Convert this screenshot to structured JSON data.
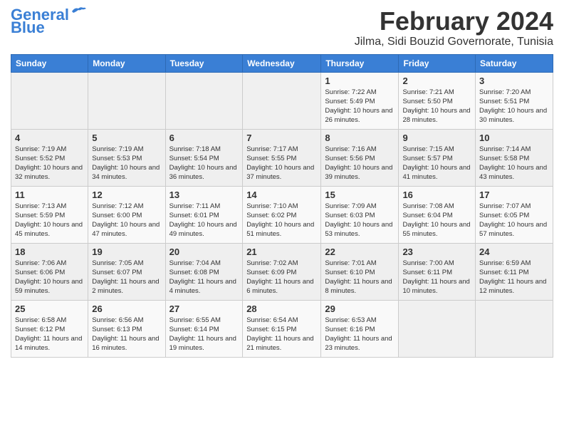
{
  "logo": {
    "line1": "General",
    "line2": "Blue"
  },
  "title": "February 2024",
  "subtitle": "Jilma, Sidi Bouzid Governorate, Tunisia",
  "days_of_week": [
    "Sunday",
    "Monday",
    "Tuesday",
    "Wednesday",
    "Thursday",
    "Friday",
    "Saturday"
  ],
  "weeks": [
    [
      {
        "day": "",
        "info": ""
      },
      {
        "day": "",
        "info": ""
      },
      {
        "day": "",
        "info": ""
      },
      {
        "day": "",
        "info": ""
      },
      {
        "day": "1",
        "info": "Sunrise: 7:22 AM\nSunset: 5:49 PM\nDaylight: 10 hours and 26 minutes."
      },
      {
        "day": "2",
        "info": "Sunrise: 7:21 AM\nSunset: 5:50 PM\nDaylight: 10 hours and 28 minutes."
      },
      {
        "day": "3",
        "info": "Sunrise: 7:20 AM\nSunset: 5:51 PM\nDaylight: 10 hours and 30 minutes."
      }
    ],
    [
      {
        "day": "4",
        "info": "Sunrise: 7:19 AM\nSunset: 5:52 PM\nDaylight: 10 hours and 32 minutes."
      },
      {
        "day": "5",
        "info": "Sunrise: 7:19 AM\nSunset: 5:53 PM\nDaylight: 10 hours and 34 minutes."
      },
      {
        "day": "6",
        "info": "Sunrise: 7:18 AM\nSunset: 5:54 PM\nDaylight: 10 hours and 36 minutes."
      },
      {
        "day": "7",
        "info": "Sunrise: 7:17 AM\nSunset: 5:55 PM\nDaylight: 10 hours and 37 minutes."
      },
      {
        "day": "8",
        "info": "Sunrise: 7:16 AM\nSunset: 5:56 PM\nDaylight: 10 hours and 39 minutes."
      },
      {
        "day": "9",
        "info": "Sunrise: 7:15 AM\nSunset: 5:57 PM\nDaylight: 10 hours and 41 minutes."
      },
      {
        "day": "10",
        "info": "Sunrise: 7:14 AM\nSunset: 5:58 PM\nDaylight: 10 hours and 43 minutes."
      }
    ],
    [
      {
        "day": "11",
        "info": "Sunrise: 7:13 AM\nSunset: 5:59 PM\nDaylight: 10 hours and 45 minutes."
      },
      {
        "day": "12",
        "info": "Sunrise: 7:12 AM\nSunset: 6:00 PM\nDaylight: 10 hours and 47 minutes."
      },
      {
        "day": "13",
        "info": "Sunrise: 7:11 AM\nSunset: 6:01 PM\nDaylight: 10 hours and 49 minutes."
      },
      {
        "day": "14",
        "info": "Sunrise: 7:10 AM\nSunset: 6:02 PM\nDaylight: 10 hours and 51 minutes."
      },
      {
        "day": "15",
        "info": "Sunrise: 7:09 AM\nSunset: 6:03 PM\nDaylight: 10 hours and 53 minutes."
      },
      {
        "day": "16",
        "info": "Sunrise: 7:08 AM\nSunset: 6:04 PM\nDaylight: 10 hours and 55 minutes."
      },
      {
        "day": "17",
        "info": "Sunrise: 7:07 AM\nSunset: 6:05 PM\nDaylight: 10 hours and 57 minutes."
      }
    ],
    [
      {
        "day": "18",
        "info": "Sunrise: 7:06 AM\nSunset: 6:06 PM\nDaylight: 10 hours and 59 minutes."
      },
      {
        "day": "19",
        "info": "Sunrise: 7:05 AM\nSunset: 6:07 PM\nDaylight: 11 hours and 2 minutes."
      },
      {
        "day": "20",
        "info": "Sunrise: 7:04 AM\nSunset: 6:08 PM\nDaylight: 11 hours and 4 minutes."
      },
      {
        "day": "21",
        "info": "Sunrise: 7:02 AM\nSunset: 6:09 PM\nDaylight: 11 hours and 6 minutes."
      },
      {
        "day": "22",
        "info": "Sunrise: 7:01 AM\nSunset: 6:10 PM\nDaylight: 11 hours and 8 minutes."
      },
      {
        "day": "23",
        "info": "Sunrise: 7:00 AM\nSunset: 6:11 PM\nDaylight: 11 hours and 10 minutes."
      },
      {
        "day": "24",
        "info": "Sunrise: 6:59 AM\nSunset: 6:11 PM\nDaylight: 11 hours and 12 minutes."
      }
    ],
    [
      {
        "day": "25",
        "info": "Sunrise: 6:58 AM\nSunset: 6:12 PM\nDaylight: 11 hours and 14 minutes."
      },
      {
        "day": "26",
        "info": "Sunrise: 6:56 AM\nSunset: 6:13 PM\nDaylight: 11 hours and 16 minutes."
      },
      {
        "day": "27",
        "info": "Sunrise: 6:55 AM\nSunset: 6:14 PM\nDaylight: 11 hours and 19 minutes."
      },
      {
        "day": "28",
        "info": "Sunrise: 6:54 AM\nSunset: 6:15 PM\nDaylight: 11 hours and 21 minutes."
      },
      {
        "day": "29",
        "info": "Sunrise: 6:53 AM\nSunset: 6:16 PM\nDaylight: 11 hours and 23 minutes."
      },
      {
        "day": "",
        "info": ""
      },
      {
        "day": "",
        "info": ""
      }
    ]
  ]
}
